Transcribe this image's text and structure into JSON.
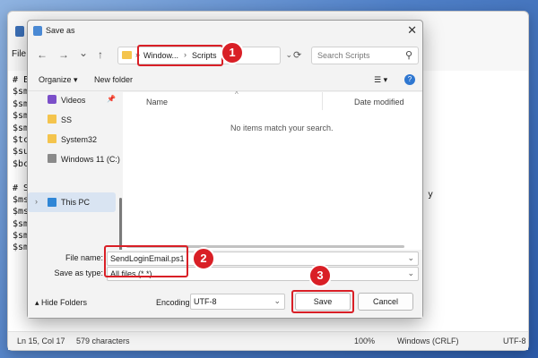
{
  "notepad": {
    "menu_first": "File",
    "code_lines": [
      "# E",
      "$sm",
      "$sm",
      "$sm",
      "$sm",
      "$tc",
      "$su",
      "$bc",
      "",
      "# S",
      "$ms",
      "$ms",
      "$sm",
      "$sm",
      "$sm"
    ],
    "right_fragment": "y",
    "status": {
      "position": "Ln 15, Col 17",
      "chars": "579 characters",
      "zoom": "100%",
      "line_endings": "Windows (CRLF)",
      "encoding": "UTF-8"
    }
  },
  "dialog": {
    "title": "Save as",
    "close_glyph": "✕",
    "nav": {
      "back": "←",
      "forward": "→",
      "recent": "⌄",
      "up": "↑",
      "refresh": "⟳"
    },
    "address": {
      "crumbs": [
        "Window...",
        "Scripts"
      ],
      "separator": "›",
      "lead_sep": "»"
    },
    "search_placeholder": "Search Scripts",
    "toolbar": {
      "organize": "Organize ▾",
      "new_folder": "New folder",
      "view": "☰ ▾",
      "help": "?"
    },
    "sidebar": [
      {
        "label": "Videos",
        "icon": "videos-icon",
        "pinned": true
      },
      {
        "label": "SS",
        "icon": "folder-icon"
      },
      {
        "label": "System32",
        "icon": "folder-icon"
      },
      {
        "label": "Windows 11 (C:)",
        "icon": "drive-icon"
      },
      {
        "label": "This PC",
        "icon": "pc-icon",
        "active": true
      }
    ],
    "columns": {
      "name": "Name",
      "date_modified": "Date modified"
    },
    "empty_message": "No items match your search.",
    "fields": {
      "filename_label": "File name:",
      "filename_value": "SendLoginEmail.ps1",
      "type_label": "Save as type:",
      "type_value": "All files  (*.*)"
    },
    "footer": {
      "hide_folders": "Hide Folders",
      "encoding_label": "Encoding:",
      "encoding_value": "UTF-8",
      "save": "Save",
      "cancel": "Cancel"
    }
  },
  "annotations": {
    "step1": "1",
    "step2": "2",
    "step3": "3",
    "color": "#d91f26"
  }
}
